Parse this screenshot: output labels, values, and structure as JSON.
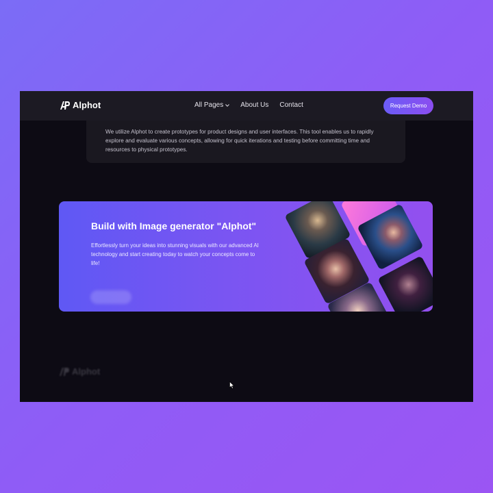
{
  "nav": {
    "logo_text": "Alphot",
    "links": [
      "All Pages",
      "About Us",
      "Contact"
    ],
    "cta_label": "Request Demo"
  },
  "testimonial": {
    "text": "We utilize Alphot to create prototypes for product designs and user interfaces. This tool enables us to rapidly explore and evaluate various concepts, allowing for quick iterations and testing before committing time and resources to physical prototypes."
  },
  "banner": {
    "title": "Build with Image generator \"Alphot\"",
    "description": "Effortlessly turn your ideas into stunning visuals with our advanced AI technology and start creating today to watch your concepts come to life!"
  },
  "footer": {
    "logo_text": "Alphot"
  },
  "colors": {
    "page_bg": "#8b5cf6",
    "window_bg": "#0d0b14",
    "nav_bg": "#1c1a23",
    "accent": "#7a55f2"
  }
}
